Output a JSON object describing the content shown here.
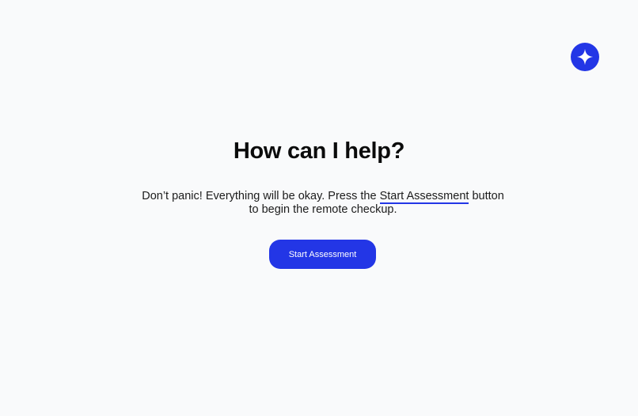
{
  "header": {
    "assistant_icon": "sparkle-icon",
    "accent_color": "#2336e6"
  },
  "main": {
    "title": "How can I help?",
    "message": {
      "before_link": "Don’t panic! Everything will be okay. Press the ",
      "link_text": "Start Assessment",
      "after_link": " button to begin the remote checkup."
    },
    "cta_label": "Start Assessment"
  }
}
